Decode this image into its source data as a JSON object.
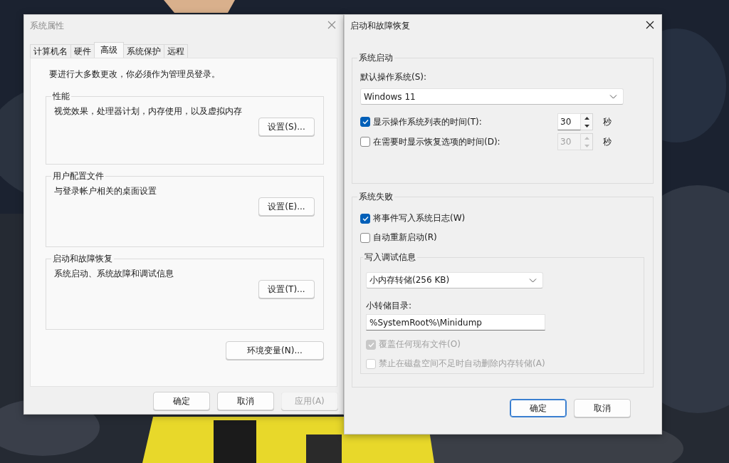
{
  "left_window": {
    "title": "系统属性",
    "active": false,
    "tabs": [
      {
        "label": "计算机名",
        "selected": false
      },
      {
        "label": "硬件",
        "selected": false
      },
      {
        "label": "高级",
        "selected": true
      },
      {
        "label": "系统保护",
        "selected": false
      },
      {
        "label": "远程",
        "selected": false
      }
    ],
    "notice": "要进行大多数更改，你必须作为管理员登录。",
    "groups": [
      {
        "title": "性能",
        "description": "视觉效果，处理器计划，内存使用，以及虚拟内存",
        "button": "设置(S)..."
      },
      {
        "title": "用户配置文件",
        "description": "与登录帐户相关的桌面设置",
        "button": "设置(E)..."
      },
      {
        "title": "启动和故障恢复",
        "description": "系统启动、系统故障和调试信息",
        "button": "设置(T)..."
      }
    ],
    "env_button": "环境变量(N)...",
    "buttons": [
      {
        "label": "确定",
        "disabled": false
      },
      {
        "label": "取消",
        "disabled": false
      },
      {
        "label": "应用(A)",
        "disabled": true
      }
    ]
  },
  "right_window": {
    "title": "启动和故障恢复",
    "active": true,
    "startup": {
      "title": "系统启动",
      "os_label": "默认操作系统(S):",
      "os_value": "Windows 11",
      "timers": [
        {
          "label": "显示操作系统列表的时间(T):",
          "checked": true,
          "value": "30",
          "unit": "秒",
          "disabled": false
        },
        {
          "label": "在需要时显示恢复选项的时间(D):",
          "checked": false,
          "value": "30",
          "unit": "秒",
          "disabled": true
        }
      ]
    },
    "failure": {
      "title": "系统失败",
      "options": [
        {
          "label": "将事件写入系统日志(W)",
          "checked": true,
          "disabled": false
        },
        {
          "label": "自动重新启动(R)",
          "checked": false,
          "disabled": false
        }
      ],
      "debug": {
        "title": "写入调试信息",
        "dump_type": "小内存转储(256 KB)",
        "dir_label": "小转储目录:",
        "dir_value": "%SystemRoot%\\Minidump",
        "options": [
          {
            "label": "覆盖任何现有文件(O)",
            "checked": true,
            "disabled": true
          },
          {
            "label": "禁止在磁盘空间不足时自动删除内存转储(A)",
            "checked": false,
            "disabled": true
          }
        ]
      }
    },
    "buttons": [
      {
        "label": "确定",
        "default": true
      },
      {
        "label": "取消",
        "default": false
      }
    ]
  }
}
